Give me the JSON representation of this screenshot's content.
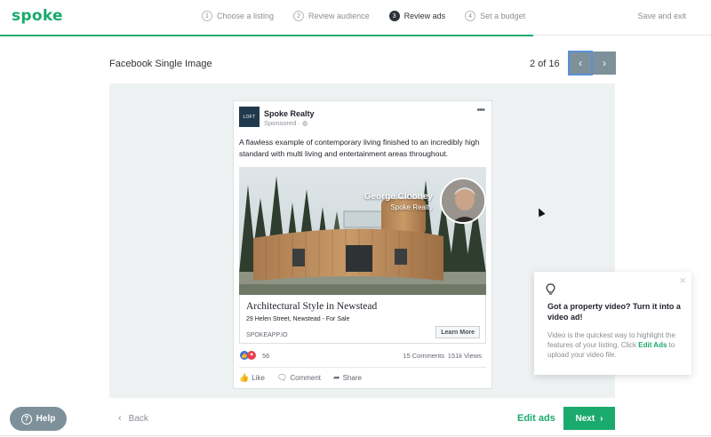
{
  "header": {
    "logo": "spoke",
    "save_exit": "Save and exit",
    "steps": [
      {
        "num": "1",
        "label": "Choose a listing"
      },
      {
        "num": "2",
        "label": "Review audience"
      },
      {
        "num": "3",
        "label": "Review ads"
      },
      {
        "num": "4",
        "label": "Set a budget"
      }
    ],
    "active_step": 3,
    "progress_fraction": 0.75
  },
  "ad": {
    "format_label": "Facebook Single Image",
    "pager_text": "2 of 16",
    "prev_icon": "chevron-left-icon",
    "next_icon": "chevron-right-icon"
  },
  "facebook_post": {
    "brand_logo_text": "LOFT",
    "page_name": "Spoke Realty",
    "sponsored": "Sponsored · ",
    "body_text": "A flawless example of contemporary living finished to an incredibly high standard with multi living and entertainment areas throughout.",
    "agent_name": "George Clooney",
    "agent_company": "Spoke Realty",
    "headline": "Architectural Style in Newstead",
    "address": "29 Helen Street, Newstead - For Sale",
    "domain": "SPOKEAPP.IO",
    "cta": "Learn More",
    "reactions_count": "56",
    "comments": "15 Comments",
    "views": "151k Views",
    "actions": {
      "like": "Like",
      "comment": "Comment",
      "share": "Share"
    }
  },
  "tip": {
    "title": "Got a property video? Turn it into a video ad!",
    "body_pre": "Video is the quickest way to highlight the features of your listing. Click ",
    "body_link": "Edit Ads",
    "body_post": " to upload your video file."
  },
  "footer": {
    "help": "Help",
    "back": "Back",
    "edit_ads": "Edit ads",
    "next": "Next"
  },
  "colors": {
    "brand_green": "#1aaa6d",
    "slate_button": "#7e9099",
    "panel_bg": "#eef1f2"
  }
}
